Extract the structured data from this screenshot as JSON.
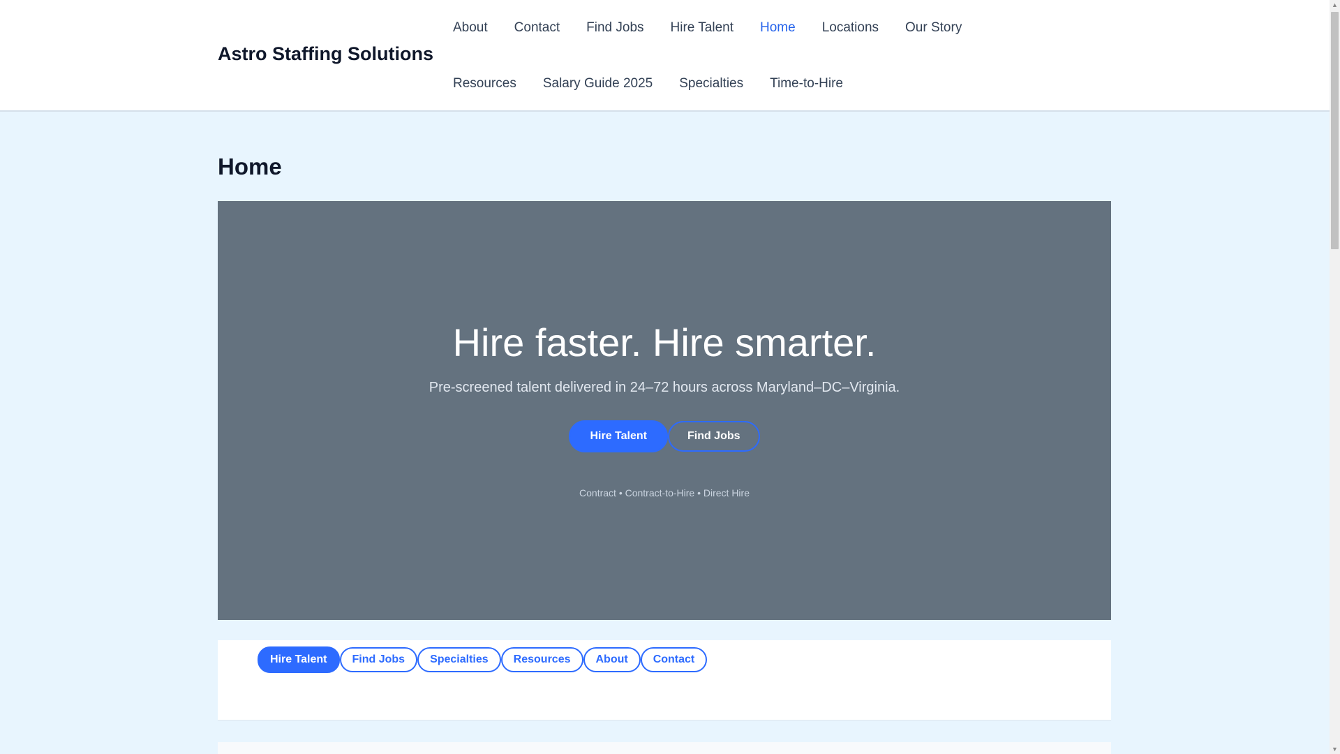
{
  "header": {
    "logo": "Astro Staffing Solutions",
    "nav": [
      "About",
      "Contact",
      "Find Jobs",
      "Hire Talent",
      "Home",
      "Locations",
      "Our Story",
      "Resources",
      "Salary Guide 2025",
      "Specialties",
      "Time-to-Hire"
    ],
    "active": "Home"
  },
  "page_title": "Home",
  "hero": {
    "title": "Hire faster. Hire smarter.",
    "subtitle": "Pre-screened talent delivered in 24–72 hours across Maryland–DC–Virginia.",
    "primary_button": "Hire Talent",
    "secondary_button": "Find Jobs",
    "tagline": "Contract • Contract-to-Hire • Direct Hire"
  },
  "quick_links": [
    "Hire Talent",
    "Find Jobs",
    "Specialties",
    "Resources",
    "About",
    "Contact"
  ],
  "colors": {
    "accent": "#2d6bff",
    "hero_bg": "#64727f",
    "page_bg": "#e8f5fe"
  }
}
